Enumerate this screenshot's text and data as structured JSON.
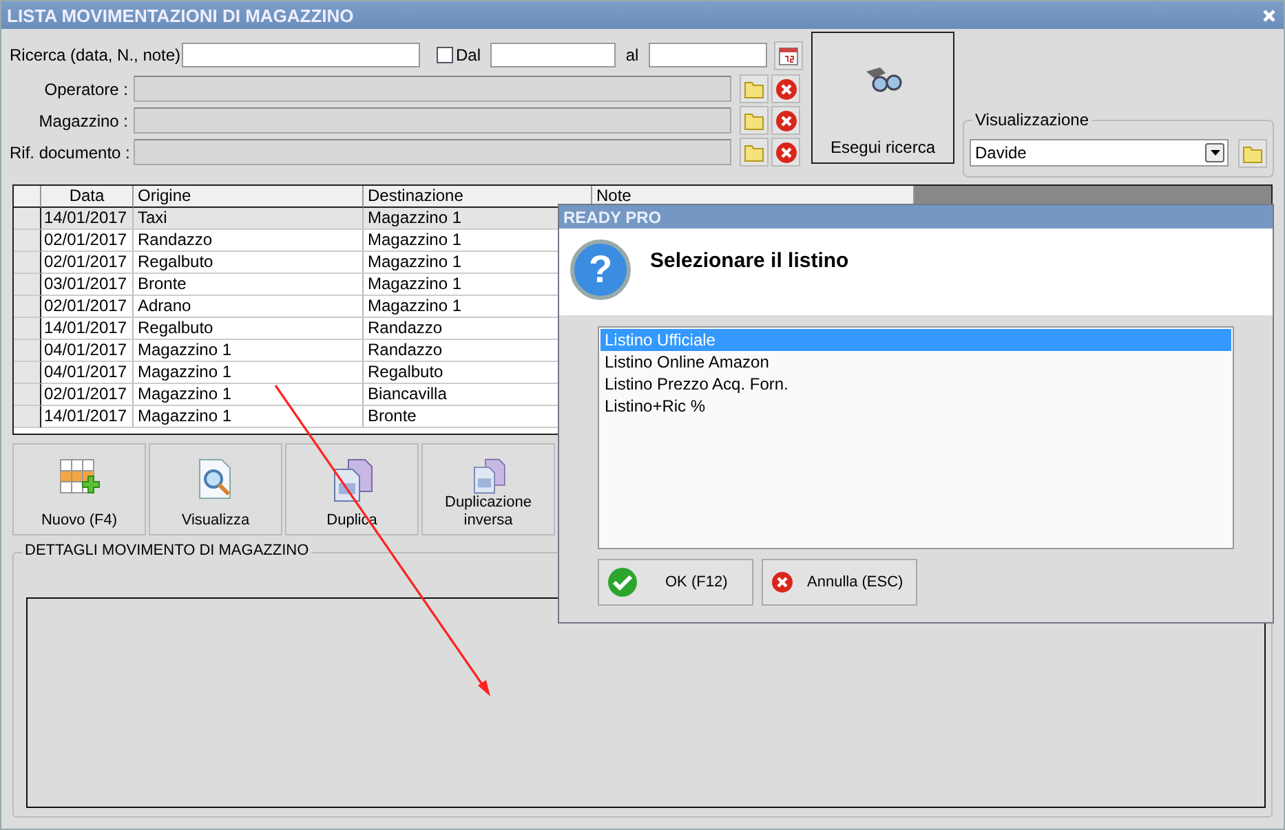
{
  "window": {
    "title": "LISTA MOVIMENTAZIONI DI MAGAZZINO"
  },
  "search": {
    "label": "Ricerca (data, N., note)",
    "date_from": {
      "label": "Dal",
      "checked": false
    },
    "date_to_label": "al"
  },
  "filters": [
    {
      "label": "Operatore :"
    },
    {
      "label": "Magazzino :"
    },
    {
      "label": "Rif. documento :"
    }
  ],
  "search_button": {
    "label": "Esegui ricerca"
  },
  "view": {
    "legend": "Visualizzazione",
    "value": "Davide"
  },
  "table": {
    "columns": [
      "Data",
      "Origine",
      "Destinazione",
      "Note"
    ],
    "rows": [
      {
        "cells": [
          "14/01/2017",
          "Taxi",
          "Magazzino 1"
        ],
        "selected": true
      },
      {
        "cells": [
          "02/01/2017",
          "Randazzo",
          "Magazzino 1"
        ],
        "selected": false
      },
      {
        "cells": [
          "02/01/2017",
          "Regalbuto",
          "Magazzino 1"
        ],
        "selected": false
      },
      {
        "cells": [
          "03/01/2017",
          "Bronte",
          "Magazzino 1"
        ],
        "selected": false
      },
      {
        "cells": [
          "02/01/2017",
          "Adrano",
          "Magazzino 1"
        ],
        "selected": false
      },
      {
        "cells": [
          "14/01/2017",
          "Regalbuto",
          "Randazzo"
        ],
        "selected": false
      },
      {
        "cells": [
          "04/01/2017",
          "Magazzino 1",
          "Randazzo"
        ],
        "selected": false
      },
      {
        "cells": [
          "04/01/2017",
          "Magazzino 1",
          "Regalbuto"
        ],
        "selected": false
      },
      {
        "cells": [
          "02/01/2017",
          "Magazzino 1",
          "Biancavilla"
        ],
        "selected": false
      },
      {
        "cells": [
          "14/01/2017",
          "Magazzino 1",
          "Bronte"
        ],
        "selected": false
      }
    ]
  },
  "toolbar": [
    {
      "kind": "new",
      "label": "Nuovo (F4)"
    },
    {
      "kind": "view",
      "label": "Visualizza"
    },
    {
      "kind": "duplicate",
      "label": "Duplica"
    },
    {
      "kind": "duplicate",
      "label": "Duplicazione inversa"
    }
  ],
  "details": {
    "title": "DETTAGLI MOVIMENTO DI MAGAZZINO"
  },
  "dialog": {
    "title": "READY PRO",
    "icon_glyph": "?",
    "heading": "Selezionare il listino",
    "options": [
      {
        "label": "Listino Ufficiale",
        "selected": true
      },
      {
        "label": "Listino Online Amazon",
        "selected": false
      },
      {
        "label": "Listino Prezzo Acq. Forn.",
        "selected": false
      },
      {
        "label": "Listino+Ric %",
        "selected": false
      }
    ],
    "buttons": [
      {
        "kind": "ok",
        "label": "OK (F12)"
      },
      {
        "kind": "cancel",
        "label": "Annulla (ESC)"
      }
    ]
  }
}
